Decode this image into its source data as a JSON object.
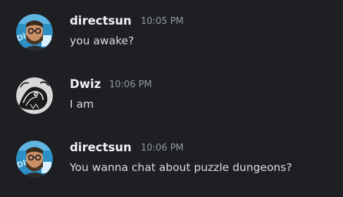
{
  "colors": {
    "background": "#1e1f22",
    "author_text": "#f2f3f5",
    "timestamp_text": "#949ba4",
    "message_text": "#dbdee1"
  },
  "messages": [
    {
      "author": "directsun",
      "timestamp": "10:05 PM",
      "content": "you awake?",
      "avatar_icon": "user-avatar-bearded-man-glasses"
    },
    {
      "author": "Dwiz",
      "timestamp": "10:06 PM",
      "content": "I am",
      "avatar_icon": "user-avatar-ink-illustration"
    },
    {
      "author": "directsun",
      "timestamp": "10:06 PM",
      "content": "You wanna chat about puzzle dungeons?",
      "avatar_icon": "user-avatar-bearded-man-glasses"
    }
  ]
}
